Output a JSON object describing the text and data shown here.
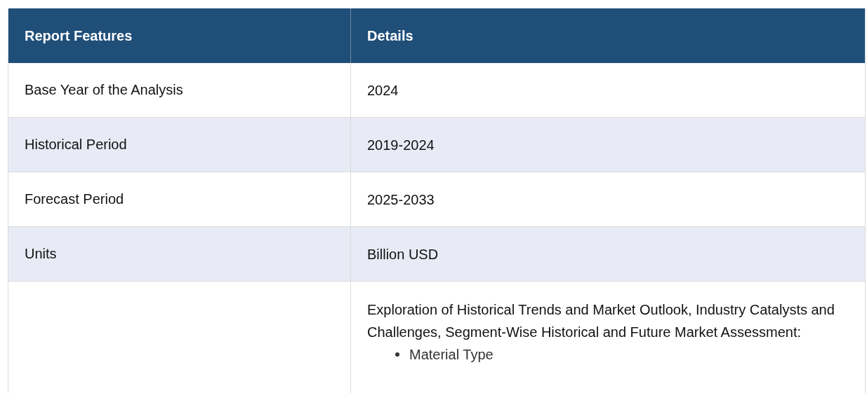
{
  "table": {
    "columns": [
      "Report Features",
      "Details"
    ],
    "rows": [
      {
        "feature": "Base Year of the Analysis",
        "details": "2024"
      },
      {
        "feature": "Historical Period",
        "details": "2019-2024"
      },
      {
        "feature": "Forecast Period",
        "details": "2025-2033"
      },
      {
        "feature": "Units",
        "details": "Billion USD"
      },
      {
        "details": "Exploration of Historical Trends and Market Outlook, Industry Catalysts and Challenges, Segment-Wise Historical and Future Market Assessment:",
        "bullets": [
          "Material Type"
        ]
      }
    ]
  }
}
